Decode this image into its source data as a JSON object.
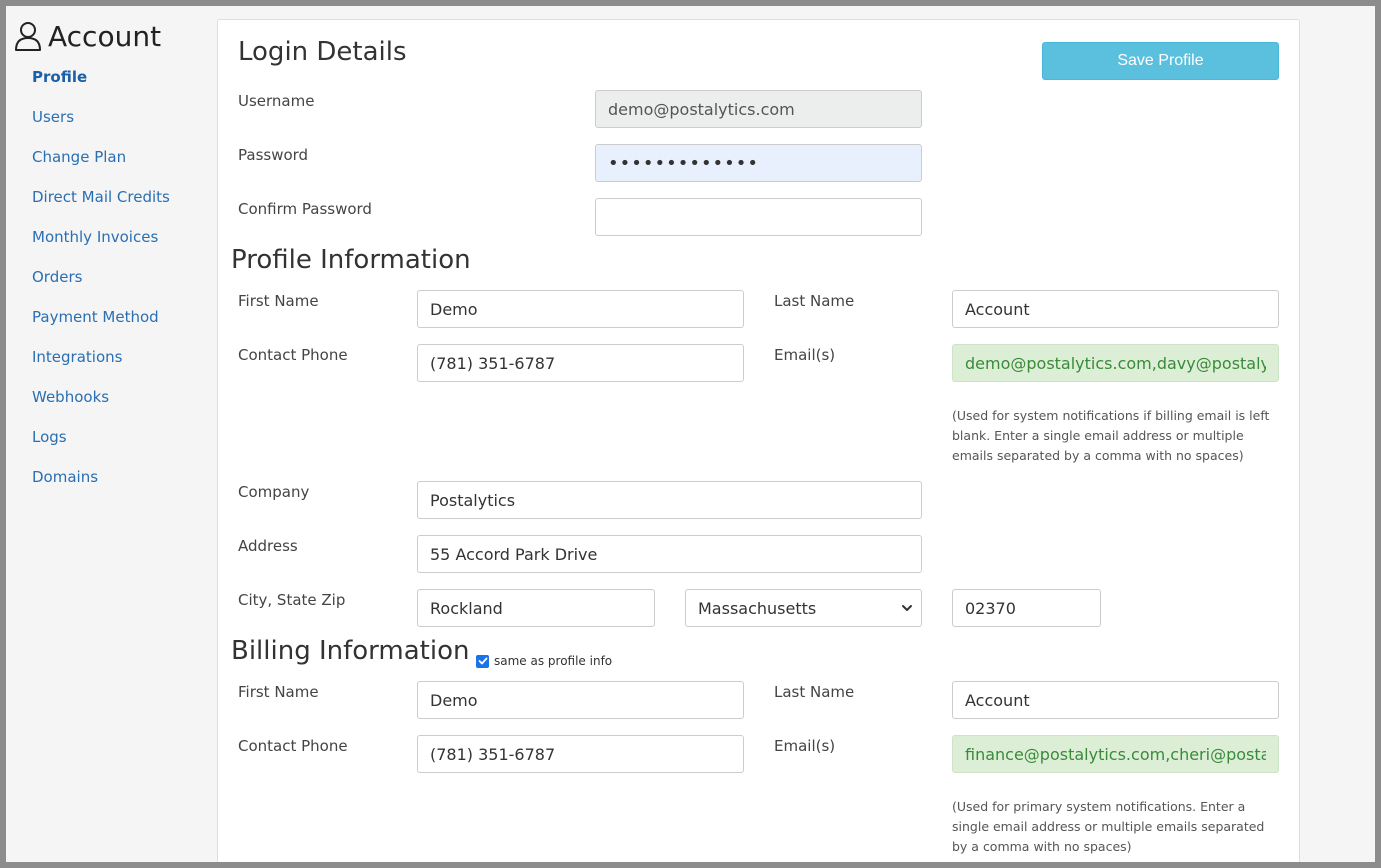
{
  "sidebar": {
    "title": "Account",
    "items": [
      {
        "label": "Profile",
        "active": true
      },
      {
        "label": "Users"
      },
      {
        "label": "Change Plan"
      },
      {
        "label": "Direct Mail Credits"
      },
      {
        "label": "Monthly Invoices"
      },
      {
        "label": "Orders"
      },
      {
        "label": "Payment Method"
      },
      {
        "label": "Integrations"
      },
      {
        "label": "Webhooks"
      },
      {
        "label": "Logs"
      },
      {
        "label": "Domains"
      }
    ]
  },
  "actions": {
    "save_label": "Save Profile"
  },
  "login": {
    "title": "Login Details",
    "username_label": "Username",
    "username_value": "demo@postalytics.com",
    "password_label": "Password",
    "password_value": "•••••••••••••",
    "confirm_label": "Confirm Password",
    "confirm_value": ""
  },
  "profile": {
    "title": "Profile Information",
    "first_name_label": "First Name",
    "first_name": "Demo",
    "last_name_label": "Last Name",
    "last_name": "Account",
    "phone_label": "Contact Phone",
    "phone": "(781) 351-6787",
    "emails_label": "Email(s)",
    "emails": "demo@postalytics.com,davy@postalytics.com",
    "emails_help": "(Used for system notifications if billing email is left blank. Enter a single email address or multiple emails separated by a comma with no spaces)",
    "company_label": "Company",
    "company": "Postalytics",
    "address_label": "Address",
    "address": "55 Accord Park Drive",
    "city_state_zip_label": "City, State Zip",
    "city": "Rockland",
    "state": "Massachusetts",
    "zip": "02370"
  },
  "billing": {
    "title": "Billing Information",
    "same_as_label": "same as profile info",
    "same_as_checked": true,
    "first_name_label": "First Name",
    "first_name": "Demo",
    "last_name_label": "Last Name",
    "last_name": "Account",
    "phone_label": "Contact Phone",
    "phone": "(781) 351-6787",
    "emails_label": "Email(s)",
    "emails": "finance@postalytics.com,cheri@postalytics.com",
    "emails_help": "(Used for primary system notifications. Enter a single email address or multiple emails separated by a comma with no spaces)"
  },
  "colors": {
    "accent": "#5bc0de",
    "link": "#2a6fb3",
    "valid_bg": "#dcefd6"
  }
}
